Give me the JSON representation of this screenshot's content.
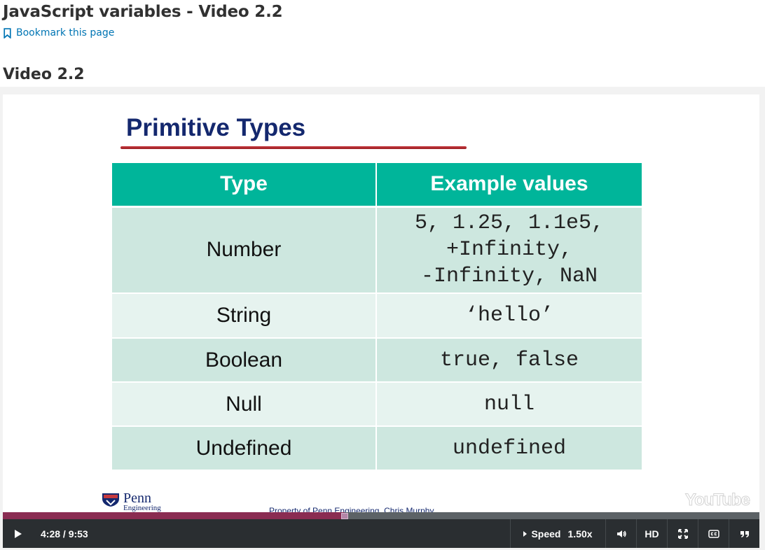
{
  "page": {
    "title": "JavaScript variables - Video 2.2",
    "bookmark_label": "Bookmark this page",
    "section_title": "Video 2.2"
  },
  "slide": {
    "title": "Primitive Types",
    "headers": [
      "Type",
      "Example values"
    ],
    "rows": [
      {
        "type": "Number",
        "values": [
          "5, 1.25, 1.1e5,",
          "+Infinity,",
          "-Infinity, NaN"
        ]
      },
      {
        "type": "String",
        "values": [
          "‘hello’"
        ]
      },
      {
        "type": "Boolean",
        "values": [
          "true, false"
        ]
      },
      {
        "type": "Null",
        "values": [
          "null"
        ]
      },
      {
        "type": "Undefined",
        "values": [
          "undefined"
        ]
      }
    ],
    "logo_text": "Penn",
    "logo_subtext": "Engineering",
    "property_text": "Property of Penn Engineering, Chris Murphy",
    "watermark": "YouTube"
  },
  "player": {
    "current_time": "4:28",
    "duration": "9:53",
    "time_display": "4:28 / 9:53",
    "progress_fraction": 0.452,
    "speed_label": "Speed",
    "speed_value": "1.50x",
    "hd_label": "HD",
    "icons": {
      "play": "play-icon",
      "volume": "volume-icon",
      "fullscreen": "fullscreen-icon",
      "captions": "captions-icon",
      "transcript": "transcript-quote-icon",
      "bookmark": "bookmark-icon"
    }
  },
  "colors": {
    "link": "#0075b4",
    "slide_title": "#14286e",
    "table_header": "#00b59a",
    "row_dark": "#cde7df",
    "row_light": "#e6f3ef",
    "progress": "#8a2c52",
    "control_bar": "#2a2e31"
  }
}
